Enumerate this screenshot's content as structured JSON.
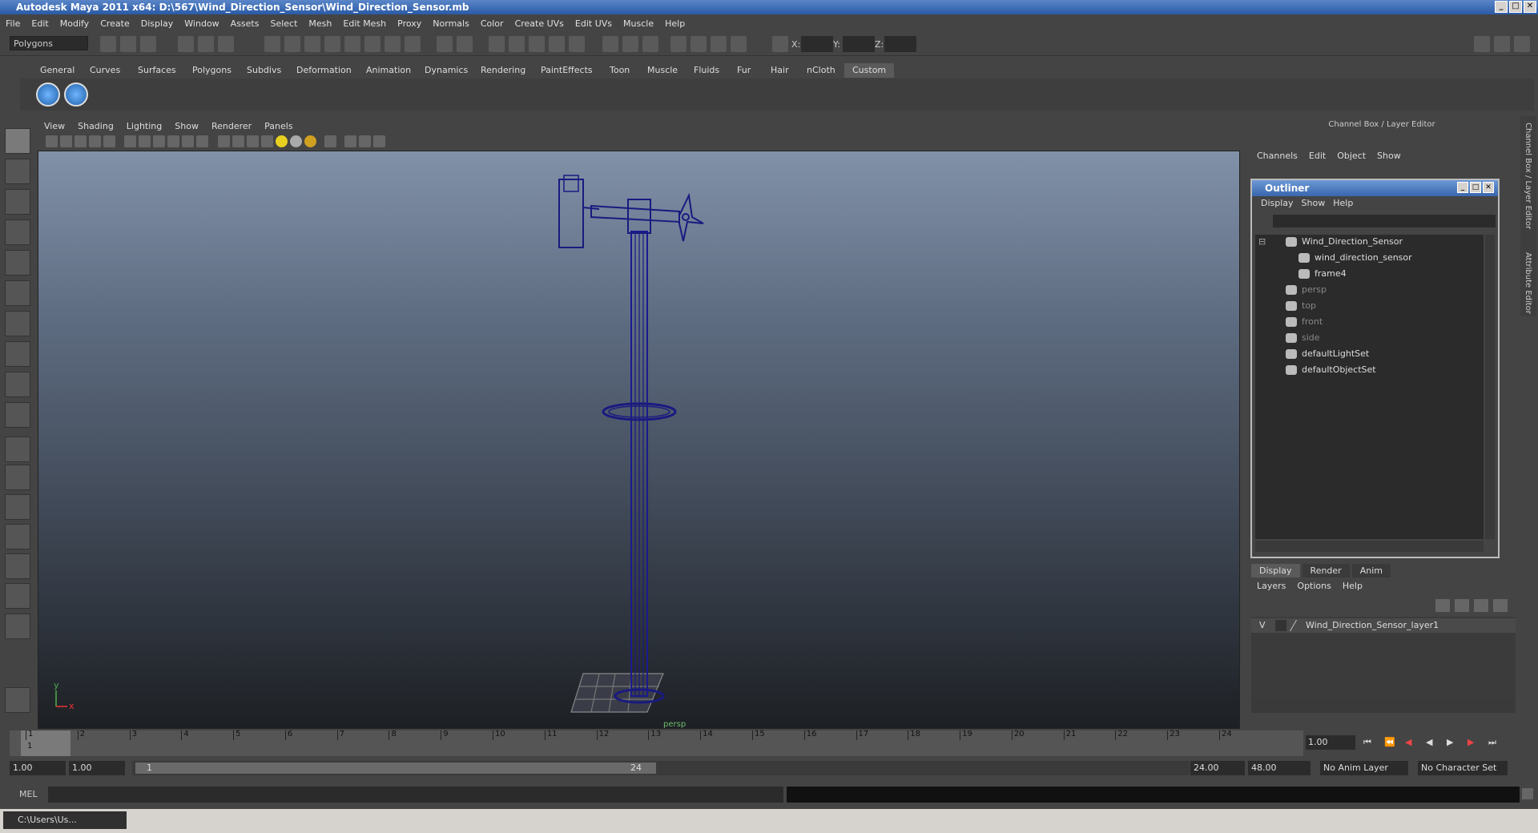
{
  "window": {
    "title": "Autodesk Maya 2011 x64: D:\\567\\Wind_Direction_Sensor\\Wind_Direction_Sensor.mb",
    "min": "_",
    "max": "□",
    "close": "✕"
  },
  "menu": [
    "File",
    "Edit",
    "Modify",
    "Create",
    "Display",
    "Window",
    "Assets",
    "Select",
    "Mesh",
    "Edit Mesh",
    "Proxy",
    "Normals",
    "Color",
    "Create UVs",
    "Edit UVs",
    "Muscle",
    "Help"
  ],
  "status": {
    "mode": "Polygons",
    "x_label": "X:",
    "y_label": "Y:",
    "z_label": "Z:"
  },
  "shelf_tabs": [
    "General",
    "Curves",
    "Surfaces",
    "Polygons",
    "Subdivs",
    "Deformation",
    "Animation",
    "Dynamics",
    "Rendering",
    "PaintEffects",
    "Toon",
    "Muscle",
    "Fluids",
    "Fur",
    "Hair",
    "nCloth",
    "Custom"
  ],
  "active_shelf_tab": "Custom",
  "viewport": {
    "menu": [
      "View",
      "Shading",
      "Lighting",
      "Show",
      "Renderer",
      "Panels"
    ],
    "camera_label": "persp",
    "axis_y": "y",
    "axis_x": "x"
  },
  "channel_box": {
    "header": "Channel Box / Layer Editor",
    "menu": [
      "Channels",
      "Edit",
      "Object",
      "Show"
    ]
  },
  "outliner": {
    "title": "Outliner",
    "menu": [
      "Display",
      "Show",
      "Help"
    ],
    "items": [
      {
        "label": "Wind_Direction_Sensor",
        "depth": 0,
        "dim": false
      },
      {
        "label": "wind_direction_sensor",
        "depth": 1,
        "dim": false
      },
      {
        "label": "frame4",
        "depth": 1,
        "dim": false
      },
      {
        "label": "persp",
        "depth": 0,
        "dim": true
      },
      {
        "label": "top",
        "depth": 0,
        "dim": true
      },
      {
        "label": "front",
        "depth": 0,
        "dim": true
      },
      {
        "label": "side",
        "depth": 0,
        "dim": true
      },
      {
        "label": "defaultLightSet",
        "depth": 0,
        "dim": false
      },
      {
        "label": "defaultObjectSet",
        "depth": 0,
        "dim": false
      }
    ]
  },
  "layer_editor": {
    "tabs": [
      "Display",
      "Render",
      "Anim"
    ],
    "menu": [
      "Layers",
      "Options",
      "Help"
    ],
    "layer_visible": "V",
    "layer_name": "Wind_Direction_Sensor_layer1"
  },
  "timeline": {
    "ticks": [
      "1",
      "2",
      "3",
      "4",
      "5",
      "6",
      "7",
      "8",
      "9",
      "10",
      "11",
      "12",
      "13",
      "14",
      "15",
      "16",
      "17",
      "18",
      "19",
      "20",
      "21",
      "22",
      "23",
      "24"
    ],
    "current_frame": "1.00",
    "current_marker": "1"
  },
  "range": {
    "start": "1.00",
    "playback_start": "1.00",
    "slider_start": "1",
    "slider_end": "24",
    "playback_end": "24.00",
    "end": "48.00",
    "anim_layer": "No Anim Layer",
    "character_set": "No Character Set"
  },
  "command": {
    "label": "MEL"
  },
  "side_tabs": {
    "channel": "Channel Box / Layer Editor",
    "attribute": "Attribute Editor"
  },
  "taskbar": {
    "item": "C:\\Users\\Us..."
  }
}
